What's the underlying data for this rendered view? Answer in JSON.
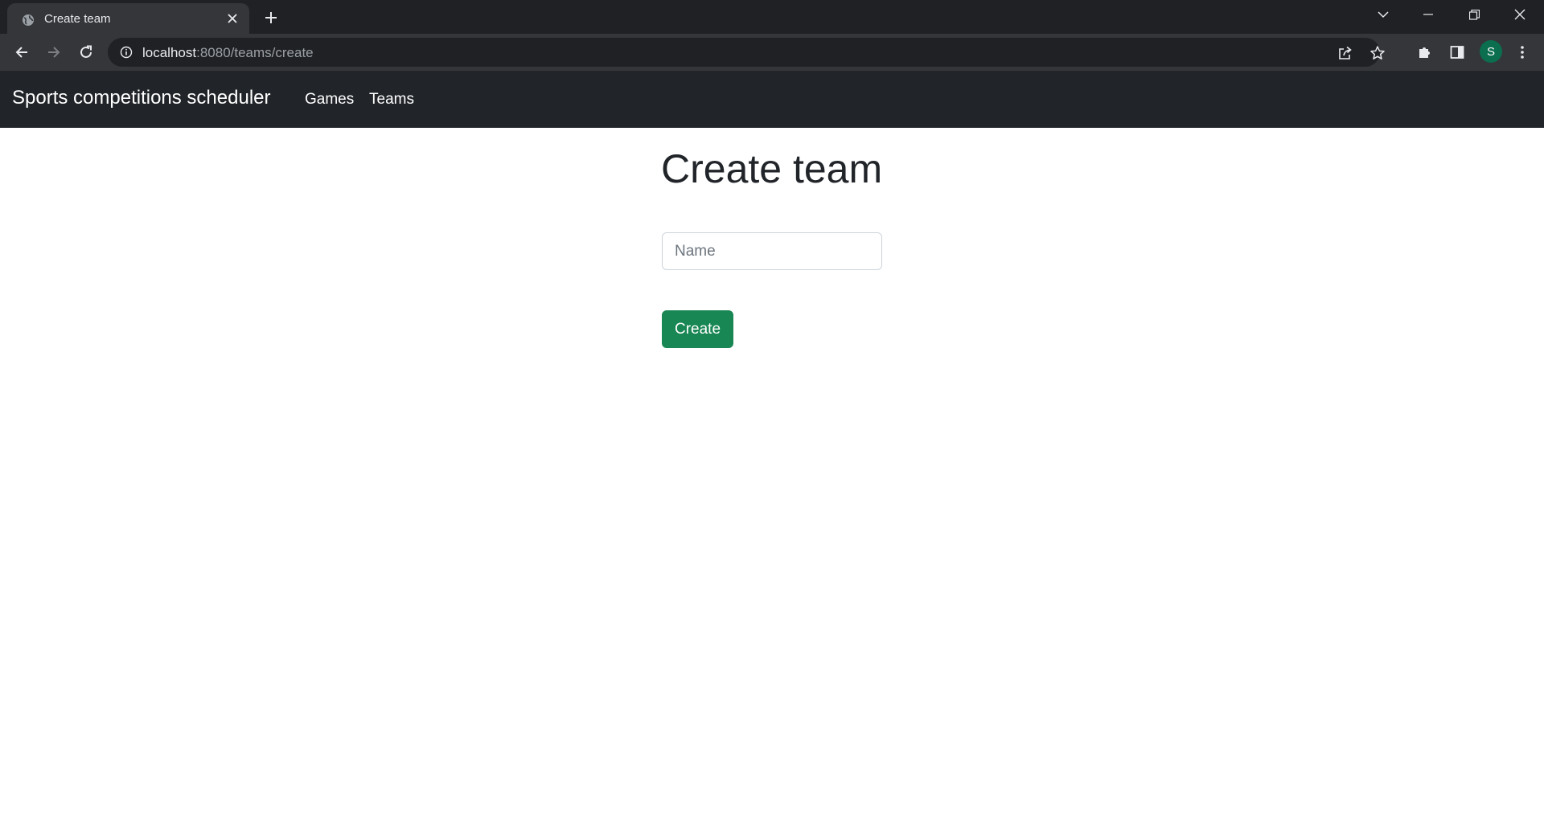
{
  "browser": {
    "tab": {
      "title": "Create team",
      "favicon": "globe-icon"
    },
    "url": {
      "host": "localhost",
      "path": ":8080/teams/create"
    },
    "profile_initial": "S",
    "icons": {
      "back": "back-arrow-icon",
      "forward": "forward-arrow-icon",
      "reload": "reload-icon",
      "info": "info-icon",
      "share": "share-icon",
      "bookmark": "star-icon",
      "extensions": "puzzle-icon",
      "side_panel": "side-panel-icon",
      "menu": "kebab-menu-icon"
    }
  },
  "navbar": {
    "brand": "Sports competitions scheduler",
    "links": [
      "Games",
      "Teams"
    ]
  },
  "main": {
    "title": "Create team",
    "name_placeholder": "Name",
    "name_value": "",
    "submit_label": "Create"
  },
  "colors": {
    "navbar_bg": "#212529",
    "primary_button": "#198754",
    "avatar_bg": "#0b6e4f"
  }
}
